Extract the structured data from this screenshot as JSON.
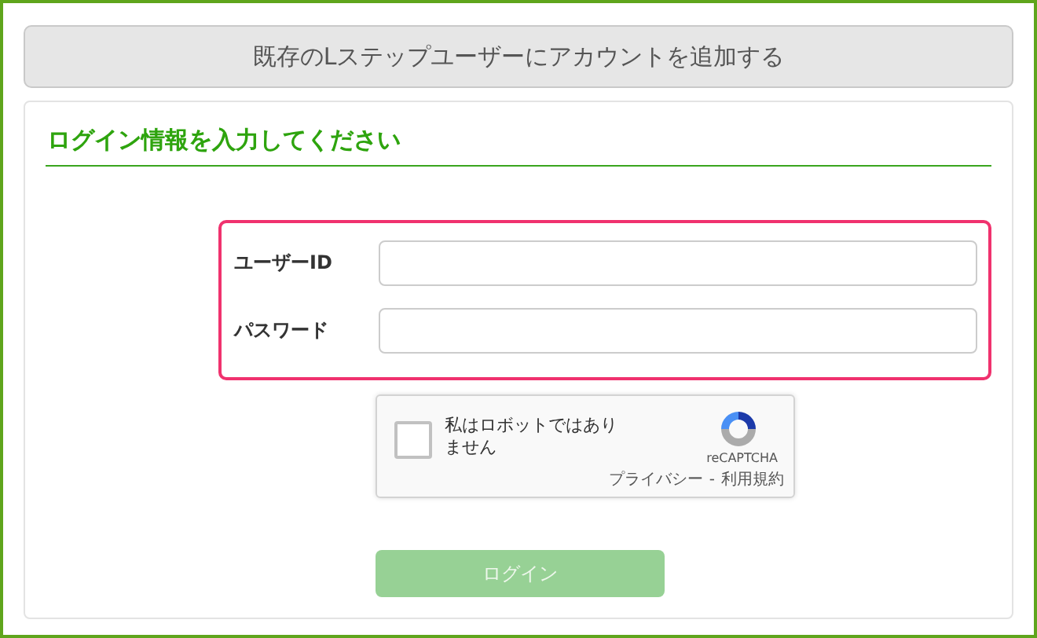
{
  "header_button": {
    "label": "既存のLステップユーザーにアカウントを追加する"
  },
  "section_title": "ログイン情報を入力してください",
  "fields": [
    {
      "label": "ユーザーID"
    },
    {
      "label": "パスワード"
    }
  ],
  "recaptcha": {
    "checked": false,
    "label": "私はロボットではありません",
    "brand": "reCAPTCHA",
    "privacy_link": "プライバシー",
    "separator": "-",
    "terms_link": "利用規約"
  },
  "login_button": {
    "label": "ログイン",
    "disabled": true
  }
}
